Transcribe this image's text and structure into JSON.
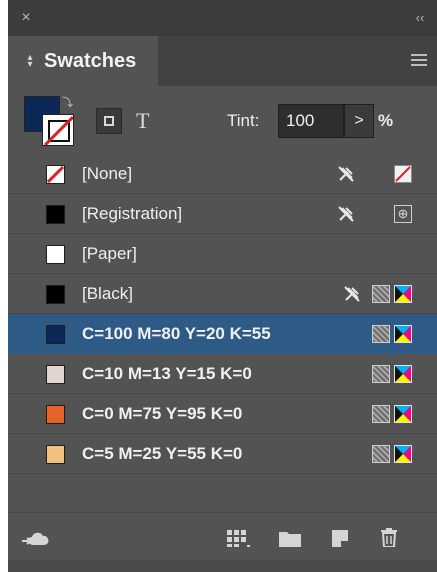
{
  "panel": {
    "title": "Swatches",
    "tab_collapse_glyph": "⌃⌄",
    "close_glyph": "×",
    "collapse_glyph": "‹‹"
  },
  "toolbar": {
    "fill_color": "#0c2857",
    "text_glyph": "T",
    "tint_label": "Tint:",
    "tint_value": "100",
    "tint_step_glyph": ">",
    "tint_unit": "%"
  },
  "swatches": [
    {
      "name": "[None]",
      "color": "none",
      "non_editable": true,
      "mode": "none"
    },
    {
      "name": "[Registration]",
      "color": "#000000",
      "non_editable": true,
      "mode": "registration"
    },
    {
      "name": "[Paper]",
      "color": "#ffffff",
      "non_editable": false,
      "mode": ""
    },
    {
      "name": "[Black]",
      "color": "#000000",
      "non_editable": true,
      "mode": "cmyk"
    },
    {
      "name": "C=100 M=80 Y=20 K=55",
      "color": "#0c2857",
      "non_editable": false,
      "mode": "cmyk",
      "selected": true
    },
    {
      "name": "C=10 M=13 Y=15 K=0",
      "color": "#e0d6cf",
      "non_editable": false,
      "mode": "cmyk"
    },
    {
      "name": "C=0 M=75 Y=95 K=0",
      "color": "#e8632a",
      "non_editable": false,
      "mode": "cmyk"
    },
    {
      "name": "C=5 M=25 Y=55 K=0",
      "color": "#efc27f",
      "non_editable": false,
      "mode": "cmyk"
    }
  ],
  "bottom_bar": {
    "icons": [
      "cc-libraries-icon",
      "show-swatch-kinds-icon",
      "new-color-group-icon",
      "new-swatch-icon",
      "delete-swatch-icon"
    ]
  },
  "colors": {
    "panel_bg": "#535353",
    "header_bg": "#3c3c3c",
    "selection": "#2e5b86"
  }
}
